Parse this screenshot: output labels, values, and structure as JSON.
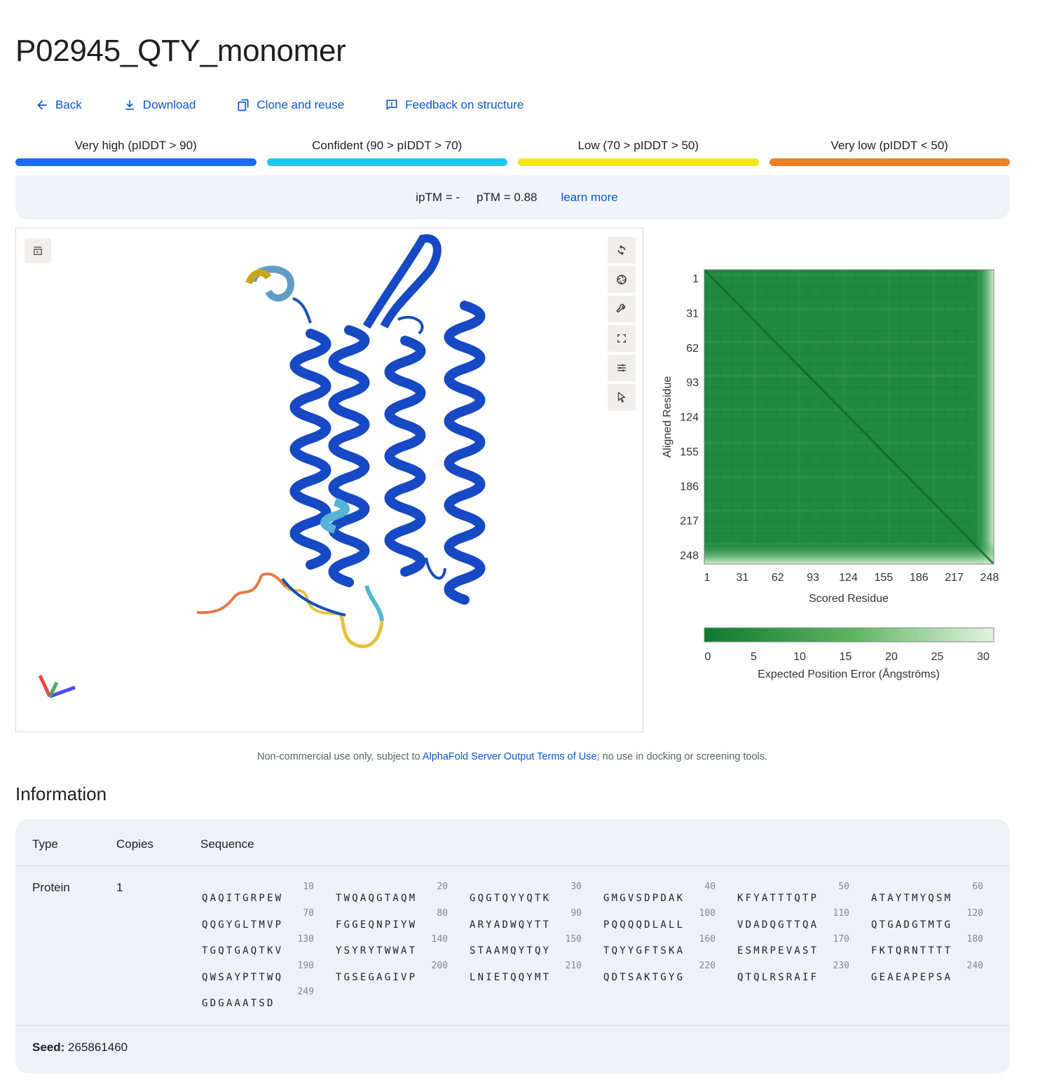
{
  "title": "P02945_QTY_monomer",
  "actions": {
    "back": "Back",
    "download": "Download",
    "clone": "Clone and reuse",
    "feedback": "Feedback on structure"
  },
  "confidence_legend": [
    {
      "label": "Very high (pIDDT > 90)",
      "color": "#1a6cf0"
    },
    {
      "label": "Confident (90 > pIDDT > 70)",
      "color": "#21c6ec"
    },
    {
      "label": "Low (70 > pIDDT > 50)",
      "color": "#f5e41d"
    },
    {
      "label": "Very low (pIDDT < 50)",
      "color": "#ee8028"
    }
  ],
  "scores": {
    "iptm": "ipTM = -",
    "ptm": "pTM = 0.88",
    "learn_more": "learn more"
  },
  "chart_data": {
    "type": "heatmap",
    "title": "",
    "xlabel": "Scored Residue",
    "ylabel": "Aligned Residue",
    "x_ticks": [
      "1",
      "31",
      "62",
      "93",
      "124",
      "155",
      "186",
      "217",
      "248"
    ],
    "y_ticks": [
      "1",
      "31",
      "62",
      "93",
      "124",
      "155",
      "186",
      "217",
      "248"
    ],
    "colorbar": {
      "label": "Expected Position Error (Ångströms)",
      "ticks": [
        "0",
        "5",
        "10",
        "15",
        "20",
        "25",
        "30"
      ],
      "range": [
        0,
        30
      ],
      "low_color": "#0b7a2e",
      "high_color": "#e2f4df"
    },
    "matrix_summary": "low error (~1-5 Å) across residues 1-~235, higher error for terminal residues ~240-249"
  },
  "notice": {
    "prefix": "Non-commercial use only, subject to ",
    "link": "AlphaFold Server Output Terms of Use",
    "suffix": "; no use in docking or screening tools."
  },
  "information": {
    "heading": "Information",
    "columns": {
      "type": "Type",
      "copies": "Copies",
      "sequence": "Sequence"
    },
    "row": {
      "type": "Protein",
      "copies": "1"
    },
    "sequence_chunks": [
      {
        "num": "10",
        "res": "QAQITGRPEW"
      },
      {
        "num": "20",
        "res": "TWQAQGTAQM"
      },
      {
        "num": "30",
        "res": "GQGTQYYQTK"
      },
      {
        "num": "40",
        "res": "GMGVSDPDAK"
      },
      {
        "num": "50",
        "res": "KFYATTTQTP"
      },
      {
        "num": "60",
        "res": "ATAYTMYQSM"
      },
      {
        "num": "70",
        "res": "QQGYGLTMVP"
      },
      {
        "num": "80",
        "res": "FGGEQNPIYW"
      },
      {
        "num": "90",
        "res": "ARYADWQYTT"
      },
      {
        "num": "100",
        "res": "PQQQQDLALL"
      },
      {
        "num": "110",
        "res": "VDADQGTTQA"
      },
      {
        "num": "120",
        "res": "QTGADGTMTG"
      },
      {
        "num": "130",
        "res": "TGQTGAQTKV"
      },
      {
        "num": "140",
        "res": "YSYRYTWWAT"
      },
      {
        "num": "150",
        "res": "STAAMQYTQY"
      },
      {
        "num": "160",
        "res": "TQYYGFTSKA"
      },
      {
        "num": "170",
        "res": "ESMRPEVAST"
      },
      {
        "num": "180",
        "res": "FKTQRNTTTT"
      },
      {
        "num": "190",
        "res": "QWSAYPTTWQ"
      },
      {
        "num": "200",
        "res": "TGSEGAGIVP"
      },
      {
        "num": "210",
        "res": "LNIETQQYMT"
      },
      {
        "num": "220",
        "res": "QDTSAKTGYG"
      },
      {
        "num": "230",
        "res": "QTQLRSRAIF"
      },
      {
        "num": "240",
        "res": "GEAEAPEPSA"
      },
      {
        "num": "249",
        "res": "GDGAAATSD"
      }
    ],
    "seed_label": "Seed:",
    "seed_value": "265861460"
  }
}
